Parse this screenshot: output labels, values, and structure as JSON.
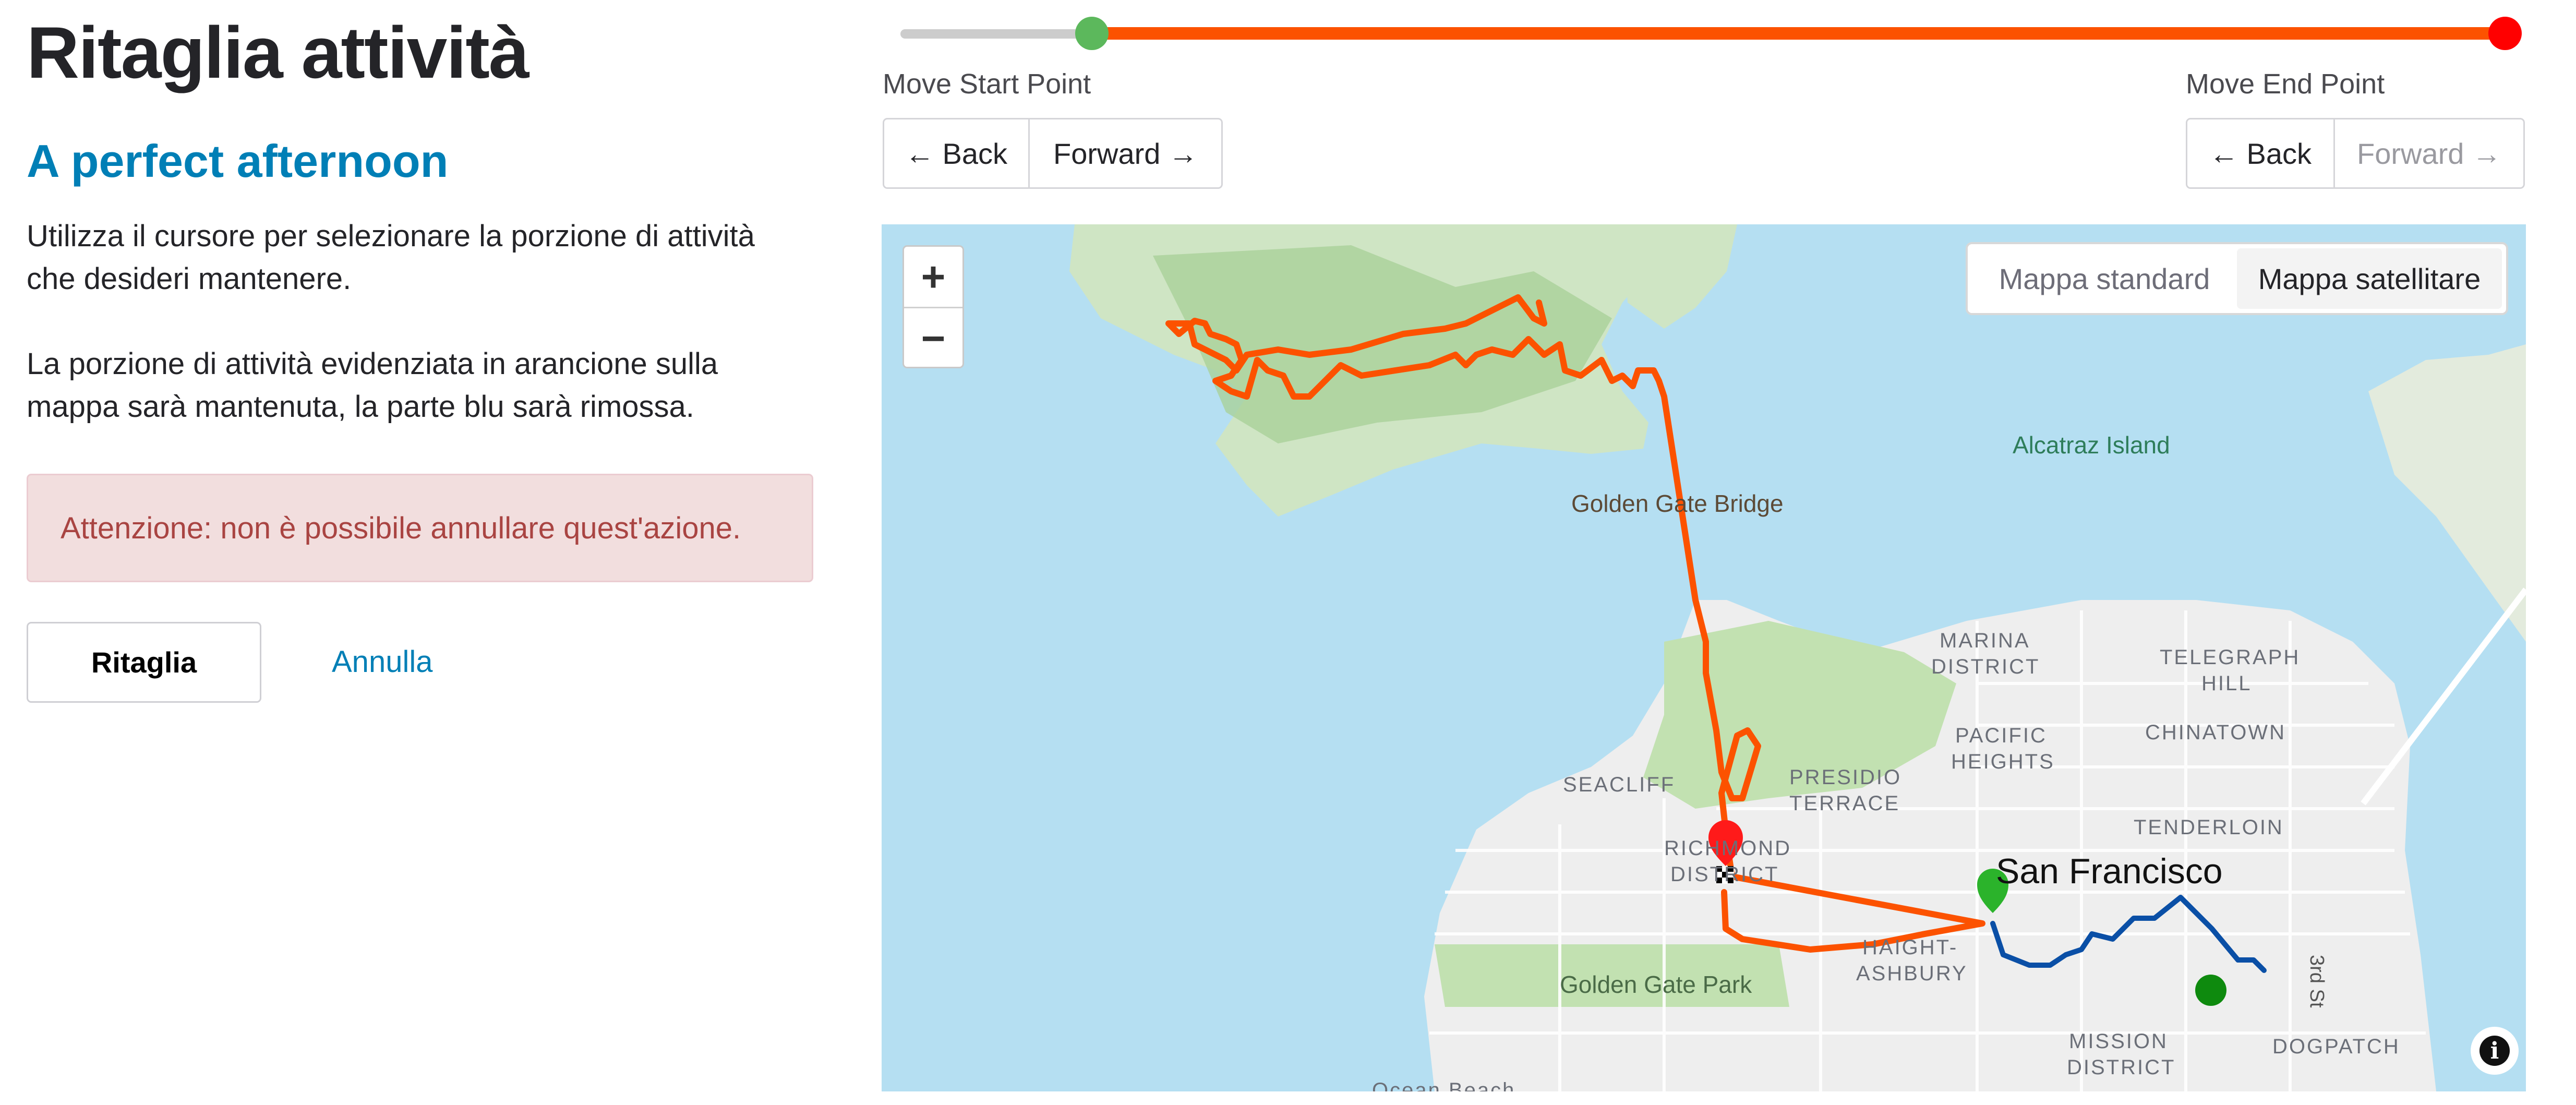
{
  "page": {
    "title": "Ritaglia attività",
    "activity_name": "A perfect afternoon",
    "description_1": "Utilizza il cursore per selezionare la porzione di attività che desideri mantenere.",
    "description_2": "La porzione di attività evidenziata in arancione sulla mappa sarà mantenuta, la parte blu sarà rimossa.",
    "warning": "Attenzione: non è possibile annullare quest'azione.",
    "crop_button": "Ritaglia",
    "cancel_link": "Annulla"
  },
  "slider": {
    "start_fraction": 0.11,
    "end_fraction": 1.0,
    "range_color": "#fc5200",
    "track_color": "#cccccc",
    "start_handle_color": "#5cb85c",
    "end_handle_color": "#ff0000"
  },
  "start_controls": {
    "label": "Move Start Point",
    "back": "← Back",
    "forward": "Forward →"
  },
  "end_controls": {
    "label": "Move End Point",
    "back": "← Back",
    "forward": "Forward →",
    "forward_disabled": true
  },
  "map": {
    "zoom_in": "+",
    "zoom_out": "−",
    "toggle": {
      "standard": "Mappa standard",
      "satellite": "Mappa satellitare",
      "active": "satellite"
    },
    "labels": {
      "alcatraz": "Alcatraz Island",
      "golden_gate_bridge": "Golden Gate Bridge",
      "marina_1": "MARINA",
      "marina_2": "DISTRICT",
      "telegraph_1": "TELEGRAPH",
      "telegraph_2": "HILL",
      "pacific_1": "PACIFIC",
      "pacific_2": "HEIGHTS",
      "chinatown": "CHINATOWN",
      "seacliff": "SEACLIFF",
      "presidio_1": "PRESIDIO",
      "presidio_2": "TERRACE",
      "tenderloin": "TENDERLOIN",
      "richmond_1": "RICHMOND",
      "richmond_2": "DISTRICT",
      "san_francisco": "San Francisco",
      "haight_1": "HAIGHT-",
      "haight_2": "ASHBURY",
      "golden_gate_park": "Golden Gate Park",
      "mission_1": "MISSION",
      "mission_2": "DISTRICT",
      "dogpatch": "DOGPATCH",
      "third_st": "3rd St",
      "ocean_beach": "Ocean Beach"
    },
    "kept_route_color": "#fc5200",
    "removed_route_color": "#0a4fa6",
    "info_icon": "i"
  }
}
